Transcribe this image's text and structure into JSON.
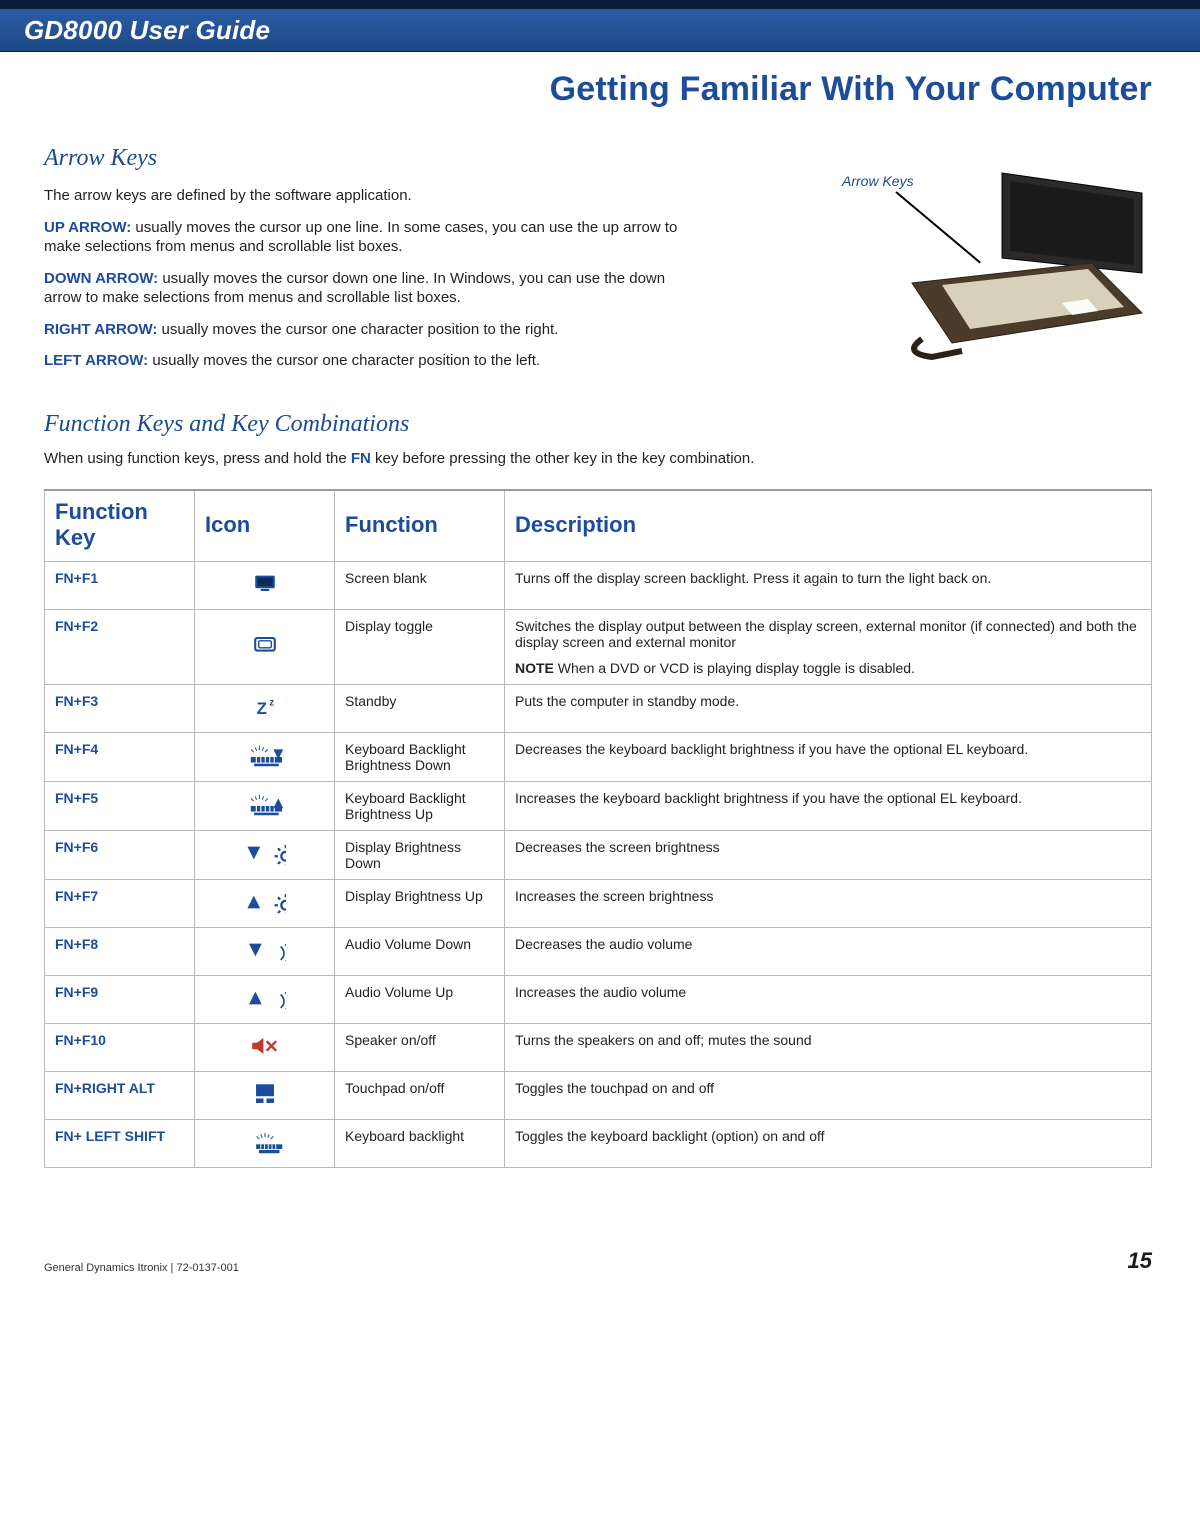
{
  "header": {
    "product_title": "GD8000 User Guide"
  },
  "section_title": "Getting Familiar With Your Computer",
  "arrow_keys": {
    "heading": "Arrow Keys",
    "intro": "The arrow keys are defined by the software application.",
    "items": [
      {
        "label": "UP ARROW:",
        "text": "usually moves the cursor up one line. In some cases, you can use the up arrow to make selections from menus and scrollable list boxes."
      },
      {
        "label": "DOWN ARROW:",
        "text": "usually moves the cursor down one line. In Windows, you can use the down arrow to make selections from menus and scrollable list boxes."
      },
      {
        "label": "RIGHT ARROW:",
        "text": "usually moves the cursor one character position to the right."
      },
      {
        "label": "LEFT ARROW:",
        "text": "usually moves the cursor one character position to the left."
      }
    ],
    "figure_caption": "Arrow Keys"
  },
  "fn_section": {
    "heading": "Function Keys and Key Combinations",
    "intro_pre": "When using function keys, press and hold the ",
    "intro_fn": "FN",
    "intro_post": " key before pressing the other key in the key combination.",
    "columns": {
      "c1": "Function Key",
      "c2": "Icon",
      "c3": "Function",
      "c4": "Description"
    },
    "rows": [
      {
        "key": "FN+F1",
        "icon": "screen-blank-icon",
        "fn": "Screen blank",
        "desc": "Turns off the display screen backlight.  Press it again to turn the light back on."
      },
      {
        "key": "FN+F2",
        "icon": "display-toggle-icon",
        "fn": "Display toggle",
        "desc": "Switches the display output between the display screen, external monitor (if connected) and both the display screen and external monitor",
        "note_label": "NOTE",
        "note_text": "  When a DVD or VCD is playing display toggle is disabled."
      },
      {
        "key": "FN+F3",
        "icon": "standby-icon",
        "fn": "Standby",
        "desc": "Puts the computer in standby mode."
      },
      {
        "key": "FN+F4",
        "icon": "kbd-backlight-down-icon",
        "fn": "Keyboard Backlight Brightness Down",
        "desc": "Decreases the keyboard backlight brightness if you have the optional EL keyboard."
      },
      {
        "key": "FN+F5",
        "icon": "kbd-backlight-up-icon",
        "fn": "Keyboard Backlight Brightness Up",
        "desc": "Increases the keyboard backlight brightness if you have the optional EL keyboard."
      },
      {
        "key": "FN+F6",
        "icon": "brightness-down-icon",
        "fn": "Display Brightness Down",
        "desc": "Decreases the screen brightness"
      },
      {
        "key": "FN+F7",
        "icon": "brightness-up-icon",
        "fn": "Display Brightness Up",
        "desc": "Increases the screen brightness"
      },
      {
        "key": "FN+F8",
        "icon": "volume-down-icon",
        "fn": "Audio Volume Down",
        "desc": "Decreases the audio volume"
      },
      {
        "key": "FN+F9",
        "icon": "volume-up-icon",
        "fn": "Audio Volume Up",
        "desc": "Increases the audio volume"
      },
      {
        "key": "FN+F10",
        "icon": "speaker-mute-icon",
        "fn": "Speaker on/off",
        "desc": "Turns the speakers on and off; mutes the sound"
      },
      {
        "key": "FN+RIGHT ALT",
        "icon": "touchpad-toggle-icon",
        "fn": "Touchpad on/off",
        "desc": "Toggles the touchpad on and off"
      },
      {
        "key": "FN+ LEFT SHIFT",
        "icon": "kbd-backlight-toggle-icon",
        "fn": "Keyboard backlight",
        "desc": "Toggles the keyboard backlight (option) on and off"
      }
    ]
  },
  "footer": {
    "left": "General Dynamics Itronix | 72-0137-001",
    "page": "15"
  }
}
